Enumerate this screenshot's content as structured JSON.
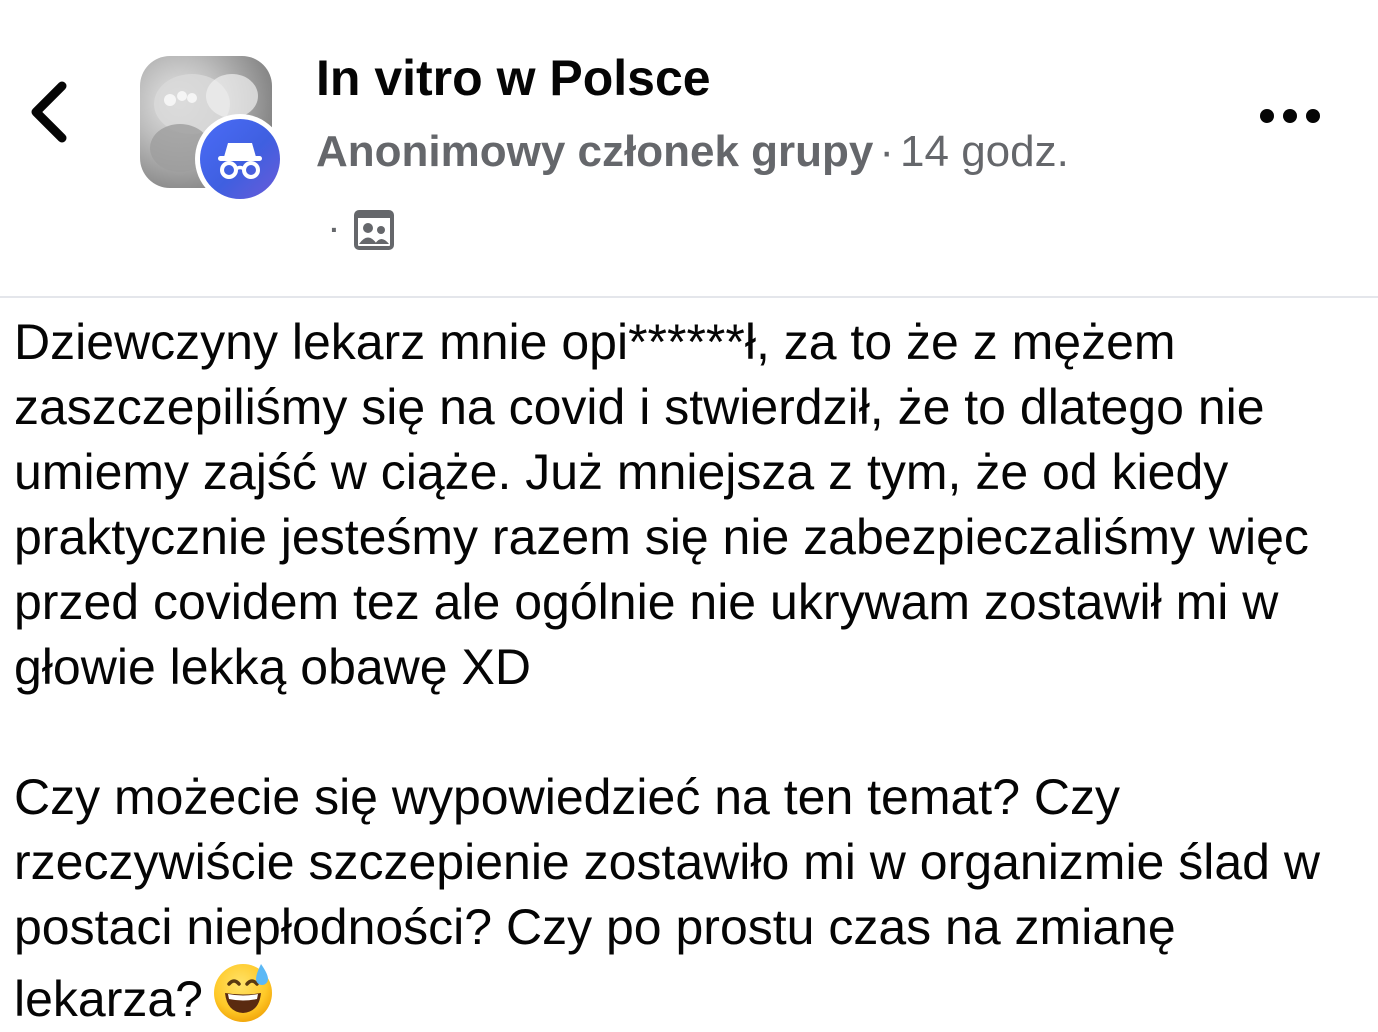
{
  "header": {
    "group_name": "In vitro w Polsce",
    "author": "Anonimowy członek grupy",
    "separator": "·",
    "time": "14 godz.",
    "privacy_separator": "·",
    "privacy_icon": "group-members-icon",
    "back_icon": "chevron-left-icon",
    "more_icon": "more-horizontal-icon"
  },
  "post": {
    "paragraph_1": "Dziewczyny lekarz mnie opi******ł, za to że z mężem zaszczepiliśmy się na covid i stwierdził, że to dlatego nie umiemy zajść w ciąże. Już mniejsza z tym, że od kiedy praktycznie jesteśmy razem się nie zabezpieczaliśmy więc przed covidem tez ale ogólnie nie ukrywam zostawił mi w głowie lekką obawę XD",
    "paragraph_2": "Czy możecie się wypowiedzieć na ten temat? Czy rzeczywiście szczepienie zostawiło mi w organizmie ślad w postaci niepłodności? Czy po prostu czas na zmianę lekarza?",
    "emoji": "grinning-face-with-sweat"
  },
  "colors": {
    "text_primary": "#050505",
    "text_secondary": "#65676b",
    "anon_badge": "#4a6cf7",
    "divider": "#e4e6eb"
  }
}
